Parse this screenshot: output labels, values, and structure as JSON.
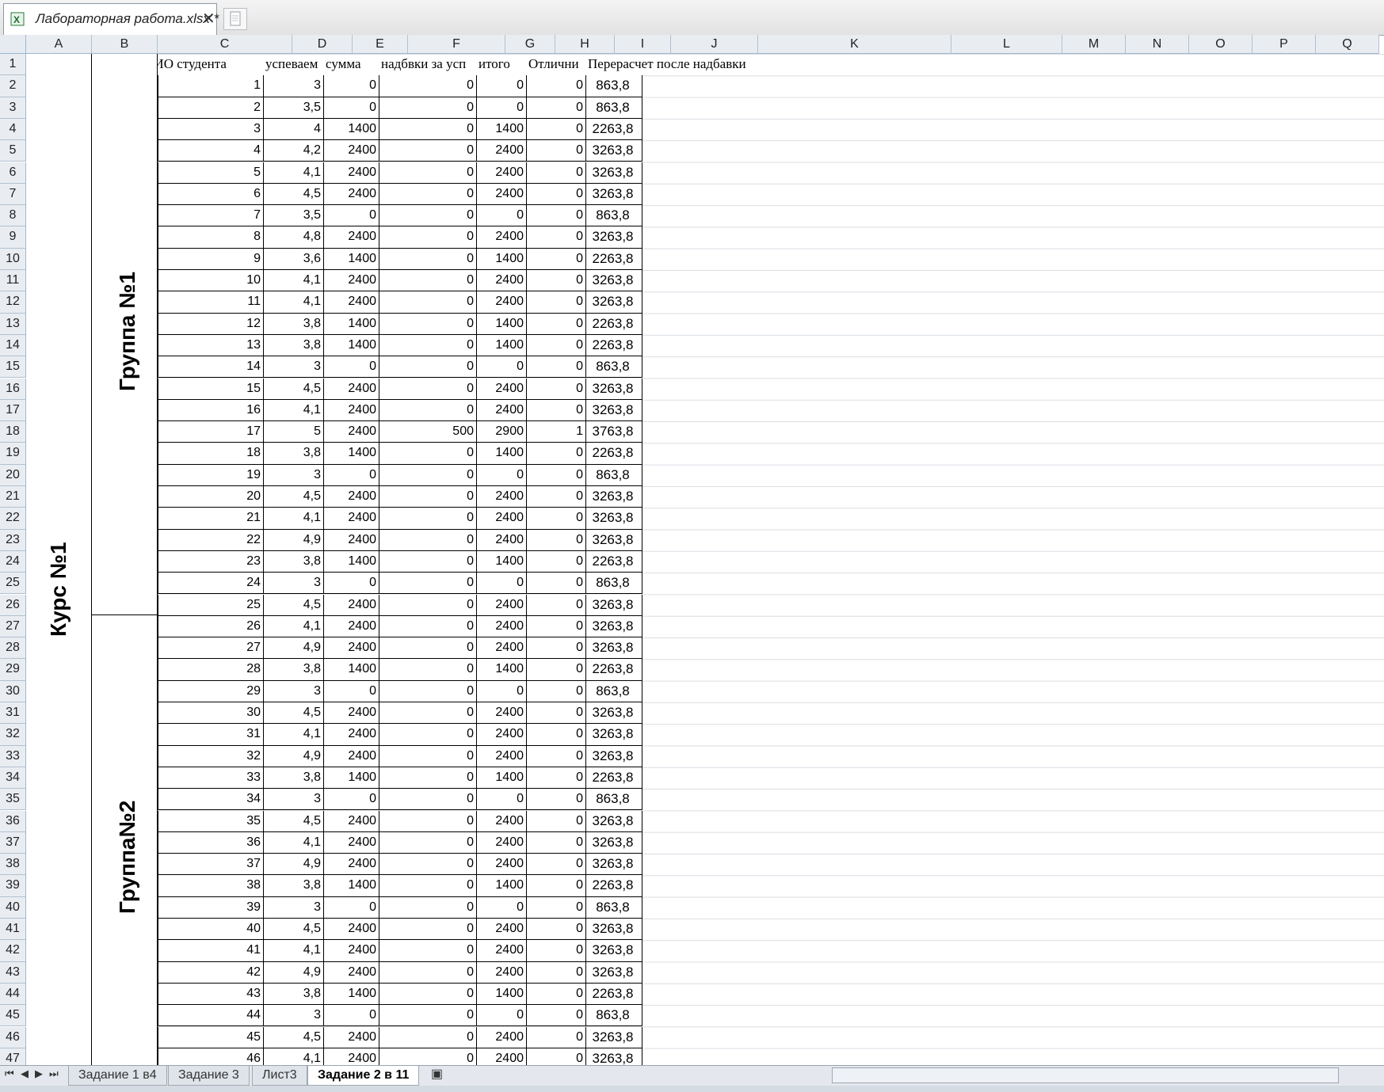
{
  "window": {
    "doc_tab_title": "Лабораторная работа.xlsx *",
    "close_symbol": "✕"
  },
  "columns": [
    "A",
    "B",
    "C",
    "D",
    "E",
    "F",
    "G",
    "H",
    "I",
    "J",
    "K",
    "L",
    "M",
    "N",
    "O",
    "P",
    "Q"
  ],
  "headers": {
    "c": "ФИО студента",
    "d": "успеваем",
    "e": "сумма",
    "f": "надбвки за усп",
    "g": "итого",
    "h": "Отлични",
    "i": "Перерасчет после надбавки"
  },
  "merged": {
    "course": "Курс №1",
    "group1": "Группа №1",
    "group2": "Группа№2"
  },
  "rows": [
    [
      "1",
      "3",
      "0",
      "0",
      "0",
      "0",
      "863,8"
    ],
    [
      "2",
      "3,5",
      "0",
      "0",
      "0",
      "0",
      "863,8"
    ],
    [
      "3",
      "4",
      "1400",
      "0",
      "1400",
      "0",
      "2263,8"
    ],
    [
      "4",
      "4,2",
      "2400",
      "0",
      "2400",
      "0",
      "3263,8"
    ],
    [
      "5",
      "4,1",
      "2400",
      "0",
      "2400",
      "0",
      "3263,8"
    ],
    [
      "6",
      "4,5",
      "2400",
      "0",
      "2400",
      "0",
      "3263,8"
    ],
    [
      "7",
      "3,5",
      "0",
      "0",
      "0",
      "0",
      "863,8"
    ],
    [
      "8",
      "4,8",
      "2400",
      "0",
      "2400",
      "0",
      "3263,8"
    ],
    [
      "9",
      "3,6",
      "1400",
      "0",
      "1400",
      "0",
      "2263,8"
    ],
    [
      "10",
      "4,1",
      "2400",
      "0",
      "2400",
      "0",
      "3263,8"
    ],
    [
      "11",
      "4,1",
      "2400",
      "0",
      "2400",
      "0",
      "3263,8"
    ],
    [
      "12",
      "3,8",
      "1400",
      "0",
      "1400",
      "0",
      "2263,8"
    ],
    [
      "13",
      "3,8",
      "1400",
      "0",
      "1400",
      "0",
      "2263,8"
    ],
    [
      "14",
      "3",
      "0",
      "0",
      "0",
      "0",
      "863,8"
    ],
    [
      "15",
      "4,5",
      "2400",
      "0",
      "2400",
      "0",
      "3263,8"
    ],
    [
      "16",
      "4,1",
      "2400",
      "0",
      "2400",
      "0",
      "3263,8"
    ],
    [
      "17",
      "5",
      "2400",
      "500",
      "2900",
      "1",
      "3763,8"
    ],
    [
      "18",
      "3,8",
      "1400",
      "0",
      "1400",
      "0",
      "2263,8"
    ],
    [
      "19",
      "3",
      "0",
      "0",
      "0",
      "0",
      "863,8"
    ],
    [
      "20",
      "4,5",
      "2400",
      "0",
      "2400",
      "0",
      "3263,8"
    ],
    [
      "21",
      "4,1",
      "2400",
      "0",
      "2400",
      "0",
      "3263,8"
    ],
    [
      "22",
      "4,9",
      "2400",
      "0",
      "2400",
      "0",
      "3263,8"
    ],
    [
      "23",
      "3,8",
      "1400",
      "0",
      "1400",
      "0",
      "2263,8"
    ],
    [
      "24",
      "3",
      "0",
      "0",
      "0",
      "0",
      "863,8"
    ],
    [
      "25",
      "4,5",
      "2400",
      "0",
      "2400",
      "0",
      "3263,8"
    ],
    [
      "26",
      "4,1",
      "2400",
      "0",
      "2400",
      "0",
      "3263,8"
    ],
    [
      "27",
      "4,9",
      "2400",
      "0",
      "2400",
      "0",
      "3263,8"
    ],
    [
      "28",
      "3,8",
      "1400",
      "0",
      "1400",
      "0",
      "2263,8"
    ],
    [
      "29",
      "3",
      "0",
      "0",
      "0",
      "0",
      "863,8"
    ],
    [
      "30",
      "4,5",
      "2400",
      "0",
      "2400",
      "0",
      "3263,8"
    ],
    [
      "31",
      "4,1",
      "2400",
      "0",
      "2400",
      "0",
      "3263,8"
    ],
    [
      "32",
      "4,9",
      "2400",
      "0",
      "2400",
      "0",
      "3263,8"
    ],
    [
      "33",
      "3,8",
      "1400",
      "0",
      "1400",
      "0",
      "2263,8"
    ],
    [
      "34",
      "3",
      "0",
      "0",
      "0",
      "0",
      "863,8"
    ],
    [
      "35",
      "4,5",
      "2400",
      "0",
      "2400",
      "0",
      "3263,8"
    ],
    [
      "36",
      "4,1",
      "2400",
      "0",
      "2400",
      "0",
      "3263,8"
    ],
    [
      "37",
      "4,9",
      "2400",
      "0",
      "2400",
      "0",
      "3263,8"
    ],
    [
      "38",
      "3,8",
      "1400",
      "0",
      "1400",
      "0",
      "2263,8"
    ],
    [
      "39",
      "3",
      "0",
      "0",
      "0",
      "0",
      "863,8"
    ],
    [
      "40",
      "4,5",
      "2400",
      "0",
      "2400",
      "0",
      "3263,8"
    ],
    [
      "41",
      "4,1",
      "2400",
      "0",
      "2400",
      "0",
      "3263,8"
    ],
    [
      "42",
      "4,9",
      "2400",
      "0",
      "2400",
      "0",
      "3263,8"
    ],
    [
      "43",
      "3,8",
      "1400",
      "0",
      "1400",
      "0",
      "2263,8"
    ],
    [
      "44",
      "3",
      "0",
      "0",
      "0",
      "0",
      "863,8"
    ],
    [
      "45",
      "4,5",
      "2400",
      "0",
      "2400",
      "0",
      "3263,8"
    ],
    [
      "46",
      "4,1",
      "2400",
      "0",
      "2400",
      "0",
      "3263,8"
    ]
  ],
  "sheet_tabs": [
    "Задание 1 в4",
    "Задание 3",
    "Лист3",
    "Задание 2 в 11"
  ],
  "active_sheet": "Задание 2 в 11",
  "icons": [
    "excel-file-icon",
    "new-document-icon",
    "close-icon",
    "first-sheet-icon",
    "prev-sheet-icon",
    "next-sheet-icon",
    "last-sheet-icon",
    "insert-sheet-icon"
  ]
}
